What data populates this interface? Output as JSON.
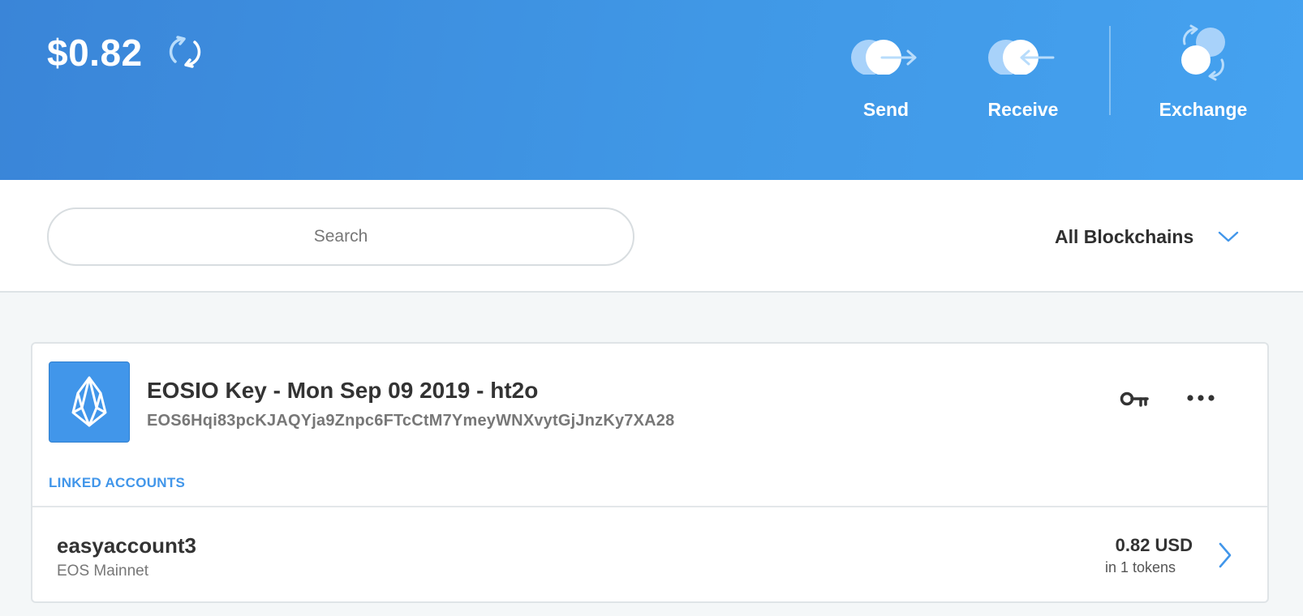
{
  "header": {
    "balance": "$0.82",
    "actions": {
      "send_label": "Send",
      "receive_label": "Receive",
      "exchange_label": "Exchange"
    }
  },
  "filters": {
    "search_placeholder": "Search",
    "search_value": "",
    "blockchain_selected": "All Blockchains"
  },
  "key_card": {
    "title": "EOSIO Key - Mon Sep 09 2019 - ht2o",
    "public_key": "EOS6Hqi83pcKJAQYja9Znpc6FTcCtM7YmeyWNXvytGjJnzKy7XA28",
    "linked_header": "LINKED ACCOUNTS",
    "accounts": [
      {
        "name": "easyaccount3",
        "network": "EOS Mainnet",
        "value": "0.82 USD",
        "tokens": "in 1 tokens"
      }
    ]
  },
  "colors": {
    "header_gradient_start": "#3a85d8",
    "header_gradient_end": "#45a2f0",
    "accent": "#4196ea",
    "background": "#f4f7f8"
  },
  "icons": {
    "refresh": "refresh-icon",
    "send": "send-icon",
    "receive": "receive-icon",
    "exchange": "exchange-icon",
    "dropdown": "chevron-down-icon",
    "logo": "eos-logo-icon",
    "key": "key-icon",
    "more": "more-icon",
    "row_arrow": "chevron-right-icon"
  }
}
